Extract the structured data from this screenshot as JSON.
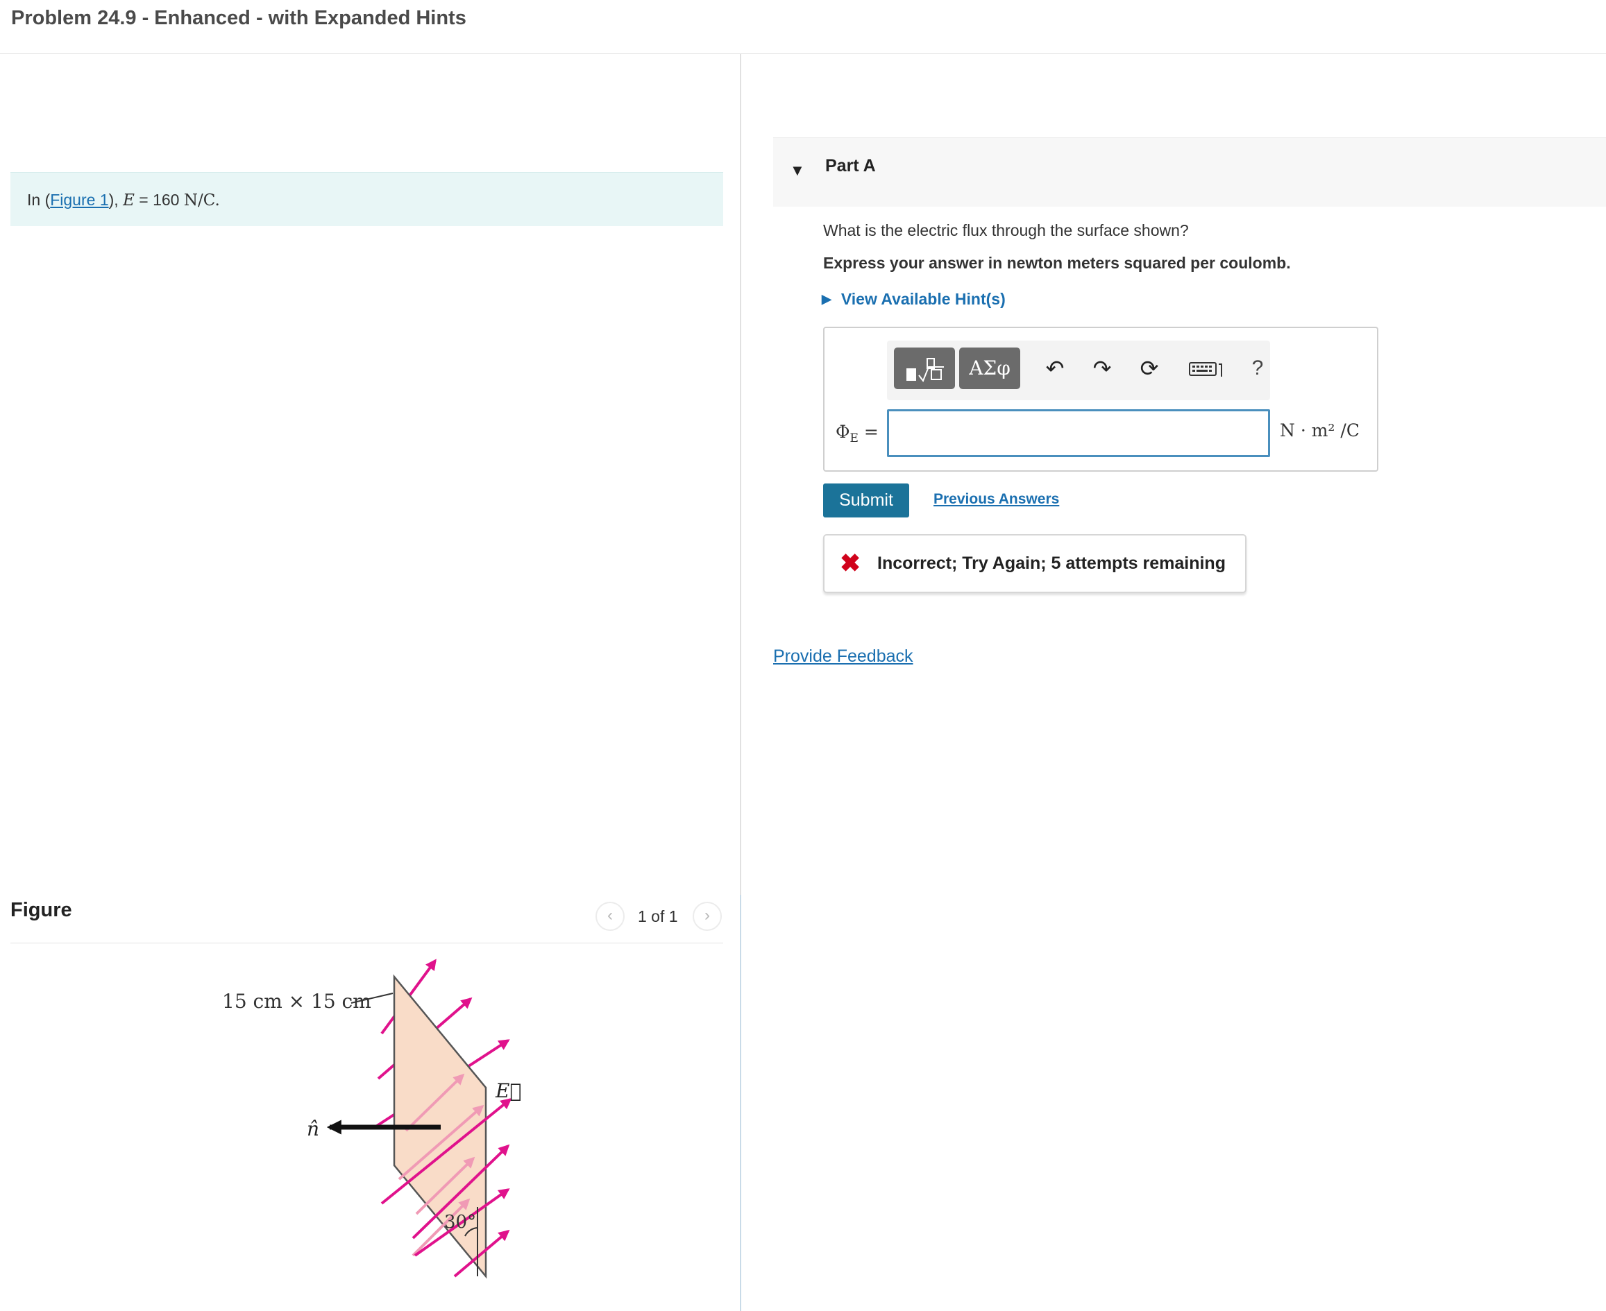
{
  "title": "Problem 24.9 - Enhanced - with Expanded Hints",
  "intro": {
    "prefix": "In (",
    "figure_link": "Figure 1",
    "suffix": "), ",
    "var": "E",
    "equals": " = 160 ",
    "unit": "N/C."
  },
  "figure": {
    "heading": "Figure",
    "pager": {
      "prev_icon": "chevron-left-icon",
      "count": "1 of 1",
      "next_icon": "chevron-right-icon"
    },
    "dimension_label": "15 cm × 15 cm",
    "normal_label": "n̂",
    "field_label": "E⃗",
    "angle_label": "30°"
  },
  "part_a": {
    "label": "Part A",
    "question": "What is the electric flux through the surface shown?",
    "express": "Express your answer in newton meters squared per coulomb.",
    "hints_label": "View Available Hint(s)",
    "toolbar": {
      "templates_icon": "templates-icon",
      "greek_label": "ΑΣφ",
      "undo_icon": "undo-icon",
      "redo_icon": "redo-icon",
      "reset_icon": "reset-icon",
      "keyboard_icon": "keyboard-icon",
      "help_label": "?"
    },
    "answer": {
      "label_symbol": "Φ",
      "label_sub": "E",
      "label_eq": " =",
      "value": "",
      "unit": "N · m² /C"
    },
    "submit_label": "Submit",
    "previous_answers_label": "Previous Answers",
    "feedback": {
      "status_icon": "x-icon",
      "text": "Incorrect; Try Again; 5 attempts remaining"
    }
  },
  "provide_feedback_label": "Provide Feedback",
  "colors": {
    "link": "#1a6fb0",
    "submit_bg": "#1b7399",
    "incorrect": "#d0021b",
    "intro_bg": "#e8f6f6",
    "field_arrow": "#e0128c",
    "plate_fill": "#f9dcc8"
  }
}
